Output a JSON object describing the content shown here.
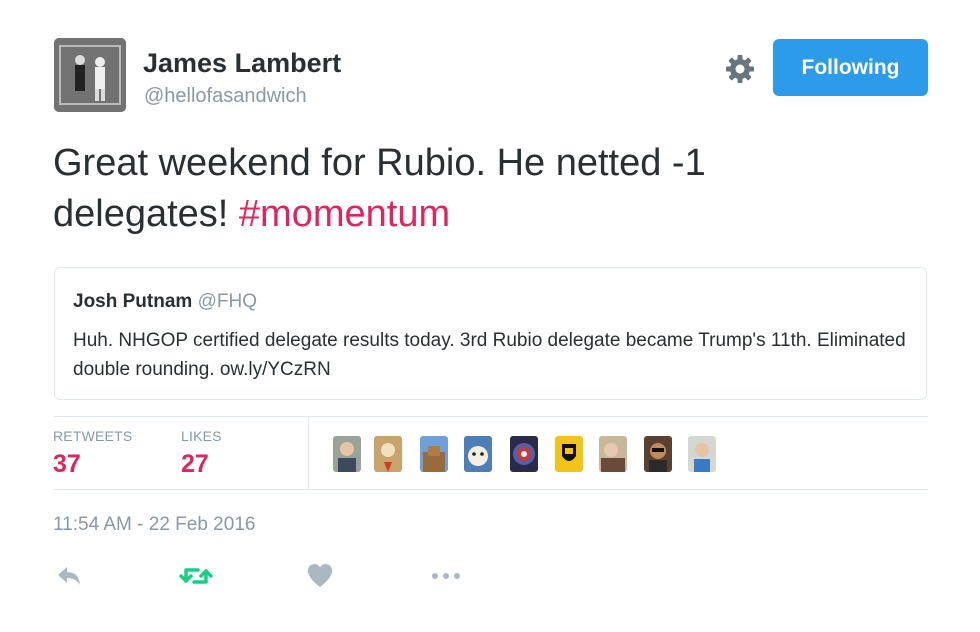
{
  "author": {
    "name": "James Lambert",
    "handle": "@hellofasandwich"
  },
  "header": {
    "follow_label": "Following",
    "colors": {
      "follow_bg": "#2b9bea"
    }
  },
  "tweet": {
    "text_main": "Great weekend for Rubio. He netted -1 delegates! ",
    "hashtag": "#momentum",
    "colors": {
      "hashtag": "#e0245e"
    }
  },
  "quoted": {
    "name": "Josh Putnam",
    "handle": "@FHQ",
    "text": "Huh. NHGOP certified delegate results today. 3rd Rubio delegate became Trump's 11th. Eliminated double rounding. ow.ly/YCzRN"
  },
  "stats": {
    "retweets_label": "RETWEETS",
    "retweets_value": "37",
    "likes_label": "LIKES",
    "likes_value": "27"
  },
  "liker_avatars": [
    "avatar-1",
    "avatar-2",
    "avatar-3",
    "avatar-4",
    "avatar-5",
    "avatar-6",
    "avatar-7",
    "avatar-8",
    "avatar-9"
  ],
  "timestamp": "11:54 AM - 22 Feb 2016",
  "actions": [
    "reply-icon",
    "retweet-icon",
    "like-icon",
    "more-icon"
  ]
}
